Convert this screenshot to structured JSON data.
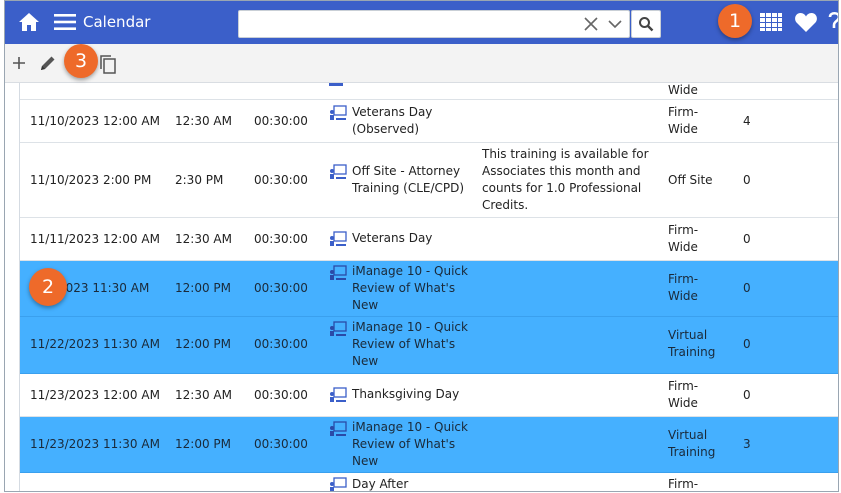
{
  "header": {
    "title": "Calendar",
    "search_value": "",
    "search_placeholder": ""
  },
  "badges": [
    "1",
    "2",
    "3"
  ],
  "colors": {
    "topbar": "#3b5fc9",
    "selected_row": "#45b0ff",
    "badge": "#ee6a2a"
  },
  "partial_top": {
    "location": "Wide"
  },
  "rows": [
    {
      "date": "11/10/2023 12:00 AM",
      "end": "12:30 AM",
      "duration": "00:30:00",
      "subject": "Veterans Day (Observed)",
      "description": "",
      "location": "Firm-Wide",
      "count": "4"
    },
    {
      "date": "11/10/2023 2:00 PM",
      "end": "2:30 PM",
      "duration": "00:30:00",
      "subject": "Off Site - Attorney Training (CLE/CPD)",
      "description": "This training is available for Associates this month and counts for 1.0 Professional Credits.",
      "location": "Off Site",
      "count": "0"
    },
    {
      "date": "11/11/2023 12:00 AM",
      "end": "12:30 AM",
      "duration": "00:30:00",
      "subject": "Veterans Day",
      "description": "",
      "location": "Firm-Wide",
      "count": "0"
    },
    {
      "date": "2023 11:30 AM",
      "end": "12:00 PM",
      "duration": "00:30:00",
      "subject": "iManage 10 - Quick Review of What's New",
      "description": "",
      "location": "Firm-Wide",
      "count": "0"
    },
    {
      "date": "11/22/2023 11:30 AM",
      "end": "12:00 PM",
      "duration": "00:30:00",
      "subject": "iManage 10 - Quick Review of What's New",
      "description": "",
      "location": "Virtual Training",
      "count": "0"
    },
    {
      "date": "11/23/2023 12:00 AM",
      "end": "12:30 AM",
      "duration": "00:30:00",
      "subject": "Thanksgiving Day",
      "description": "",
      "location": "Firm-Wide",
      "count": "0"
    },
    {
      "date": "11/23/2023 11:30 AM",
      "end": "12:00 PM",
      "duration": "00:30:00",
      "subject": "iManage 10 - Quick Review of What's New",
      "description": "",
      "location": "Virtual Training",
      "count": "3"
    },
    {
      "date": "",
      "end": "",
      "duration": "",
      "subject": "Day After",
      "description": "",
      "location": "Firm-",
      "count": ""
    }
  ]
}
